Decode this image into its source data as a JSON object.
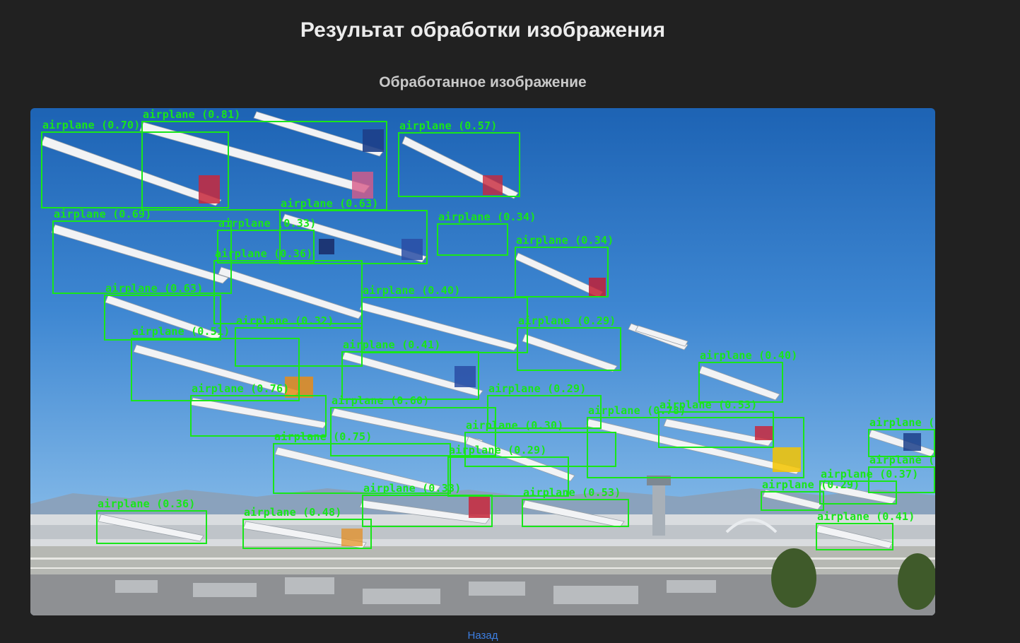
{
  "page": {
    "title": "Результат обработки изображения",
    "section_title": "Обработанное изображение",
    "back_link": "Назад"
  },
  "image": {
    "description_name": "processed-detection-image",
    "box_color": "#19e619"
  },
  "detections": [
    {
      "label": "airplane (0.70)"
    },
    {
      "label": "airplane (0.81)"
    },
    {
      "label": "airplane (0.57)"
    },
    {
      "label": "airplane (0.63)"
    },
    {
      "label": "airplane (0.69)"
    },
    {
      "label": "airplane (0.33)"
    },
    {
      "label": "airplane (0.34)"
    },
    {
      "label": "airplane (0.34)"
    },
    {
      "label": "airplane (0.36)"
    },
    {
      "label": "airplane (0.63)"
    },
    {
      "label": "airplane (0.40)"
    },
    {
      "label": "airplane (0.32)"
    },
    {
      "label": "airplane (0.29)"
    },
    {
      "label": "airplane (0.51)"
    },
    {
      "label": "airplane (0.41)"
    },
    {
      "label": "airplane (0.40)"
    },
    {
      "label": "airplane (0.76)"
    },
    {
      "label": "airplane (0.29)"
    },
    {
      "label": "airplane (0.60)"
    },
    {
      "label": "airplane (0.78)"
    },
    {
      "label": "airplane (0.53)"
    },
    {
      "label": "airplane (0."
    },
    {
      "label": "airplane (0.30)"
    },
    {
      "label": "airplane (0.75)"
    },
    {
      "label": "airplane (0.29)"
    },
    {
      "label": "airplane (0."
    },
    {
      "label": "airplane (0.37)"
    },
    {
      "label": "airplane (0.33)"
    },
    {
      "label": "airplane (0.53)"
    },
    {
      "label": "airplane (0.29)"
    },
    {
      "label": "airplane (0.36)"
    },
    {
      "label": "airplane (0.48)"
    },
    {
      "label": "airplane (0.41)"
    }
  ]
}
